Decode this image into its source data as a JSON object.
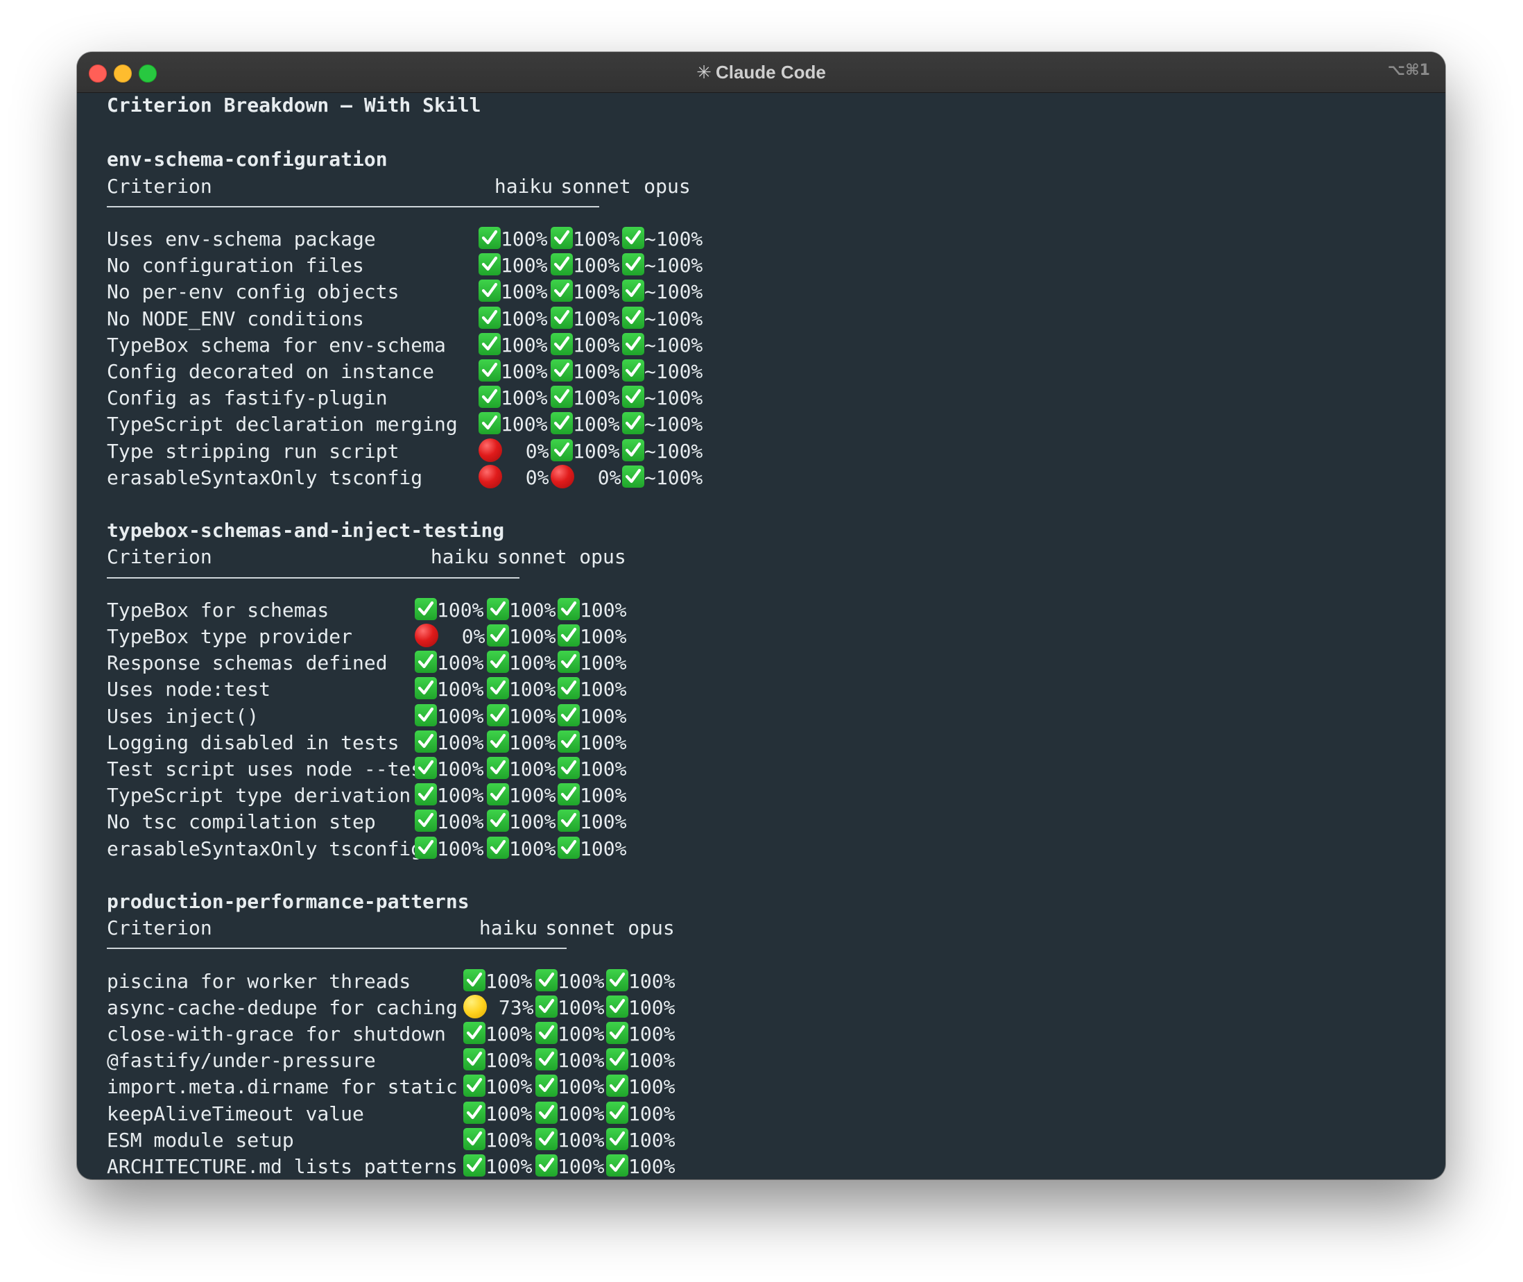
{
  "window": {
    "title": "Claude Code",
    "spinner_glyph": "✳",
    "shortcut": "⌥⌘1"
  },
  "heading": "Criterion Breakdown — With Skill",
  "sections": [
    {
      "name": "env-schema-configuration",
      "col_criterion": "Criterion",
      "models": [
        "haiku",
        "sonnet",
        "opus"
      ],
      "rows": [
        {
          "criterion": "Uses env-schema package",
          "cells": [
            {
              "status": "check",
              "value": "100%"
            },
            {
              "status": "check",
              "value": "100%"
            },
            {
              "status": "check",
              "value": "~100%"
            }
          ]
        },
        {
          "criterion": "No configuration files",
          "cells": [
            {
              "status": "check",
              "value": "100%"
            },
            {
              "status": "check",
              "value": "100%"
            },
            {
              "status": "check",
              "value": "~100%"
            }
          ]
        },
        {
          "criterion": "No per-env config objects",
          "cells": [
            {
              "status": "check",
              "value": "100%"
            },
            {
              "status": "check",
              "value": "100%"
            },
            {
              "status": "check",
              "value": "~100%"
            }
          ]
        },
        {
          "criterion": "No NODE_ENV conditions",
          "cells": [
            {
              "status": "check",
              "value": "100%"
            },
            {
              "status": "check",
              "value": "100%"
            },
            {
              "status": "check",
              "value": "~100%"
            }
          ]
        },
        {
          "criterion": "TypeBox schema for env-schema",
          "cells": [
            {
              "status": "check",
              "value": "100%"
            },
            {
              "status": "check",
              "value": "100%"
            },
            {
              "status": "check",
              "value": "~100%"
            }
          ]
        },
        {
          "criterion": "Config decorated on instance",
          "cells": [
            {
              "status": "check",
              "value": "100%"
            },
            {
              "status": "check",
              "value": "100%"
            },
            {
              "status": "check",
              "value": "~100%"
            }
          ]
        },
        {
          "criterion": "Config as fastify-plugin",
          "cells": [
            {
              "status": "check",
              "value": "100%"
            },
            {
              "status": "check",
              "value": "100%"
            },
            {
              "status": "check",
              "value": "~100%"
            }
          ]
        },
        {
          "criterion": "TypeScript declaration merging",
          "cells": [
            {
              "status": "check",
              "value": "100%"
            },
            {
              "status": "check",
              "value": "100%"
            },
            {
              "status": "check",
              "value": "~100%"
            }
          ]
        },
        {
          "criterion": "Type stripping run script",
          "cells": [
            {
              "status": "red",
              "value": "  0%"
            },
            {
              "status": "check",
              "value": "100%"
            },
            {
              "status": "check",
              "value": "~100%"
            }
          ]
        },
        {
          "criterion": "erasableSyntaxOnly tsconfig",
          "cells": [
            {
              "status": "red",
              "value": "  0%"
            },
            {
              "status": "red",
              "value": "  0%"
            },
            {
              "status": "check",
              "value": "~100%"
            }
          ]
        }
      ]
    },
    {
      "name": "typebox-schemas-and-inject-testing",
      "col_criterion": "Criterion",
      "models": [
        "haiku",
        "sonnet",
        "opus"
      ],
      "rows": [
        {
          "criterion": "TypeBox for schemas",
          "cells": [
            {
              "status": "check",
              "value": "100%"
            },
            {
              "status": "check",
              "value": "100%"
            },
            {
              "status": "check",
              "value": "100%"
            }
          ]
        },
        {
          "criterion": "TypeBox type provider",
          "cells": [
            {
              "status": "red",
              "value": "  0%"
            },
            {
              "status": "check",
              "value": "100%"
            },
            {
              "status": "check",
              "value": "100%"
            }
          ]
        },
        {
          "criterion": "Response schemas defined",
          "cells": [
            {
              "status": "check",
              "value": "100%"
            },
            {
              "status": "check",
              "value": "100%"
            },
            {
              "status": "check",
              "value": "100%"
            }
          ]
        },
        {
          "criterion": "Uses node:test",
          "cells": [
            {
              "status": "check",
              "value": "100%"
            },
            {
              "status": "check",
              "value": "100%"
            },
            {
              "status": "check",
              "value": "100%"
            }
          ]
        },
        {
          "criterion": "Uses inject()",
          "cells": [
            {
              "status": "check",
              "value": "100%"
            },
            {
              "status": "check",
              "value": "100%"
            },
            {
              "status": "check",
              "value": "100%"
            }
          ]
        },
        {
          "criterion": "Logging disabled in tests",
          "cells": [
            {
              "status": "check",
              "value": "100%"
            },
            {
              "status": "check",
              "value": "100%"
            },
            {
              "status": "check",
              "value": "100%"
            }
          ]
        },
        {
          "criterion": "Test script uses node --test",
          "cells": [
            {
              "status": "check",
              "value": "100%"
            },
            {
              "status": "check",
              "value": "100%"
            },
            {
              "status": "check",
              "value": "100%"
            }
          ]
        },
        {
          "criterion": "TypeScript type derivation",
          "cells": [
            {
              "status": "check",
              "value": "100%"
            },
            {
              "status": "check",
              "value": "100%"
            },
            {
              "status": "check",
              "value": "100%"
            }
          ]
        },
        {
          "criterion": "No tsc compilation step",
          "cells": [
            {
              "status": "check",
              "value": "100%"
            },
            {
              "status": "check",
              "value": "100%"
            },
            {
              "status": "check",
              "value": "100%"
            }
          ]
        },
        {
          "criterion": "erasableSyntaxOnly tsconfig",
          "cells": [
            {
              "status": "check",
              "value": "100%"
            },
            {
              "status": "check",
              "value": "100%"
            },
            {
              "status": "check",
              "value": "100%"
            }
          ]
        }
      ]
    },
    {
      "name": "production-performance-patterns",
      "col_criterion": "Criterion",
      "models": [
        "haiku",
        "sonnet",
        "opus"
      ],
      "rows": [
        {
          "criterion": "piscina for worker threads",
          "cells": [
            {
              "status": "check",
              "value": "100%"
            },
            {
              "status": "check",
              "value": "100%"
            },
            {
              "status": "check",
              "value": "100%"
            }
          ]
        },
        {
          "criterion": "async-cache-dedupe for caching",
          "cells": [
            {
              "status": "yellow",
              "value": " 73%"
            },
            {
              "status": "check",
              "value": "100%"
            },
            {
              "status": "check",
              "value": "100%"
            }
          ]
        },
        {
          "criterion": "close-with-grace for shutdown",
          "cells": [
            {
              "status": "check",
              "value": "100%"
            },
            {
              "status": "check",
              "value": "100%"
            },
            {
              "status": "check",
              "value": "100%"
            }
          ]
        },
        {
          "criterion": "@fastify/under-pressure",
          "cells": [
            {
              "status": "check",
              "value": "100%"
            },
            {
              "status": "check",
              "value": "100%"
            },
            {
              "status": "check",
              "value": "100%"
            }
          ]
        },
        {
          "criterion": "import.meta.dirname for static",
          "cells": [
            {
              "status": "check",
              "value": "100%"
            },
            {
              "status": "check",
              "value": "100%"
            },
            {
              "status": "check",
              "value": "100%"
            }
          ]
        },
        {
          "criterion": "keepAliveTimeout value",
          "cells": [
            {
              "status": "check",
              "value": "100%"
            },
            {
              "status": "check",
              "value": "100%"
            },
            {
              "status": "check",
              "value": "100%"
            }
          ]
        },
        {
          "criterion": "ESM module setup",
          "cells": [
            {
              "status": "check",
              "value": "100%"
            },
            {
              "status": "check",
              "value": "100%"
            },
            {
              "status": "check",
              "value": "100%"
            }
          ]
        },
        {
          "criterion": "ARCHITECTURE.md lists patterns",
          "cells": [
            {
              "status": "check",
              "value": "100%"
            },
            {
              "status": "check",
              "value": "100%"
            },
            {
              "status": "check",
              "value": "100%"
            }
          ]
        }
      ]
    }
  ]
}
